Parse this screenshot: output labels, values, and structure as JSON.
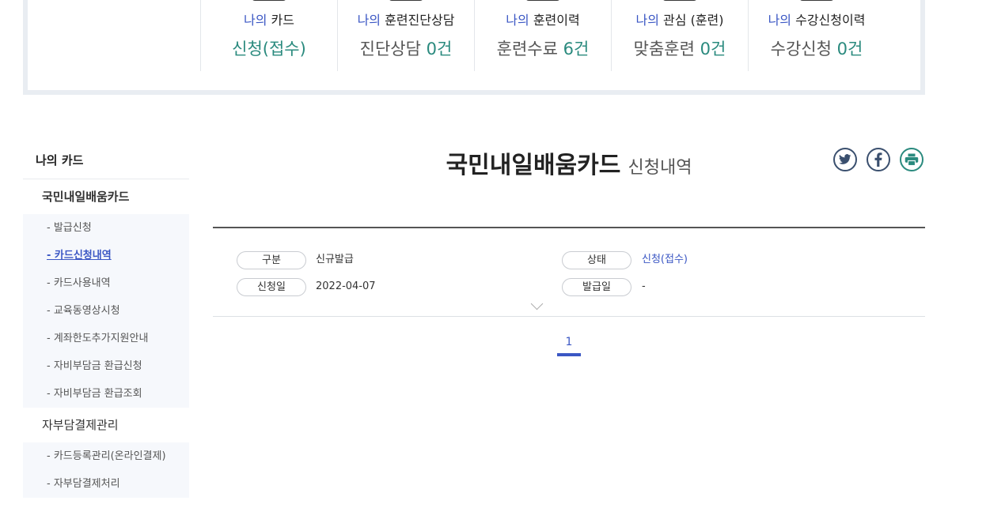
{
  "summary": {
    "items": [
      {
        "prefix": "나의",
        "label": "카드",
        "value_text": "신청(접수)",
        "value_num": ""
      },
      {
        "prefix": "나의",
        "label": "훈련진단상담",
        "value_text": "진단상담",
        "value_num": "0건"
      },
      {
        "prefix": "나의",
        "label": "훈련이력",
        "value_text": "훈련수료",
        "value_num": "6건"
      },
      {
        "prefix": "나의",
        "label": "관심 (훈련)",
        "value_text": "맞춤훈련",
        "value_num": "0건"
      },
      {
        "prefix": "나의",
        "label": "수강신청이력",
        "value_text": "수강신청",
        "value_num": "0건"
      }
    ]
  },
  "sidebar": {
    "title": "나의 카드",
    "groups": [
      {
        "label": "국민내일배움카드",
        "items": [
          "- 발급신청",
          "- 카드신청내역",
          "- 카드사용내역",
          "- 교육동영상시청",
          "- 계좌한도추가지원안내",
          "- 자비부담금 환급신청",
          "- 자비부담금 환급조회"
        ]
      },
      {
        "label": "자부담결제관리",
        "items": [
          "- 카드등록관리(온라인결제)",
          "- 자부담결제처리"
        ]
      }
    ]
  },
  "content": {
    "title_main": "국민내일배움카드",
    "title_sub": "신청내역",
    "share_icons": [
      "twitter-icon",
      "facebook-icon",
      "print-icon"
    ],
    "fields": {
      "type_label": "구분",
      "type_value": "신규발급",
      "status_label": "상태",
      "status_value": "신청(접수)",
      "date_label": "신청일",
      "date_value": "2022-04-07",
      "issue_label": "발급일",
      "issue_value": "-"
    },
    "pagination": {
      "current": "1"
    }
  },
  "colors": {
    "accent": "#3b57c4",
    "teal": "#2a8a7e"
  }
}
